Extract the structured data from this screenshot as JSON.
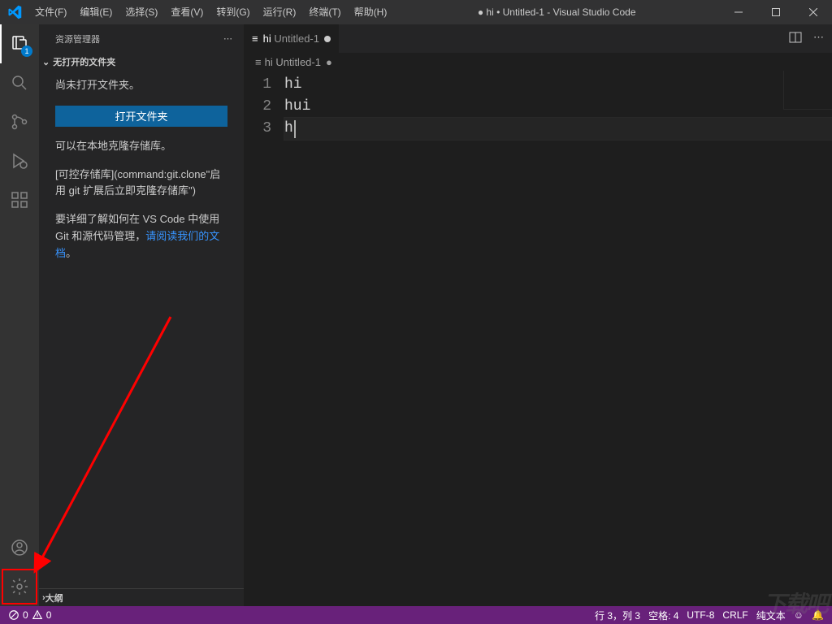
{
  "window": {
    "title": "● hi • Untitled-1 - Visual Studio Code"
  },
  "menubar": {
    "items": [
      "文件(F)",
      "编辑(E)",
      "选择(S)",
      "查看(V)",
      "转到(G)",
      "运行(R)",
      "终端(T)",
      "帮助(H)"
    ]
  },
  "activitybar": {
    "explorer_badge": "1"
  },
  "sidebar": {
    "header": "资源管理器",
    "section_title": "无打开的文件夹",
    "no_folder_msg": "尚未打开文件夹。",
    "open_folder_btn": "打开文件夹",
    "clone_msg": "可以在本地克隆存储库。",
    "clone_cmd": "[可控存储库](command:git.clone\"启用 git 扩展后立即克隆存储库\")",
    "docs_prefix": "要详细了解如何在 VS Code 中使用 Git 和源代码管理，",
    "docs_link": "请阅读我们的文档",
    "docs_suffix": "。",
    "outline_title": "大纲"
  },
  "tab": {
    "icon_label": "≡",
    "name_prefix": "hi",
    "name_rest": "Untitled-1"
  },
  "breadcrumb": {
    "icon_label": "≡",
    "text": "hi Untitled-1"
  },
  "editor": {
    "lines": [
      "hi",
      "hui",
      "h"
    ],
    "line_numbers": [
      "1",
      "2",
      "3"
    ]
  },
  "statusbar": {
    "errors": "0",
    "warnings": "0",
    "cursor": "行 3，列 3",
    "spaces": "空格: 4",
    "encoding": "UTF-8",
    "eol": "CRLF",
    "language": "纯文本",
    "feedback_icon": "☺",
    "bell_icon": "🔔"
  },
  "watermark": "下载吧"
}
